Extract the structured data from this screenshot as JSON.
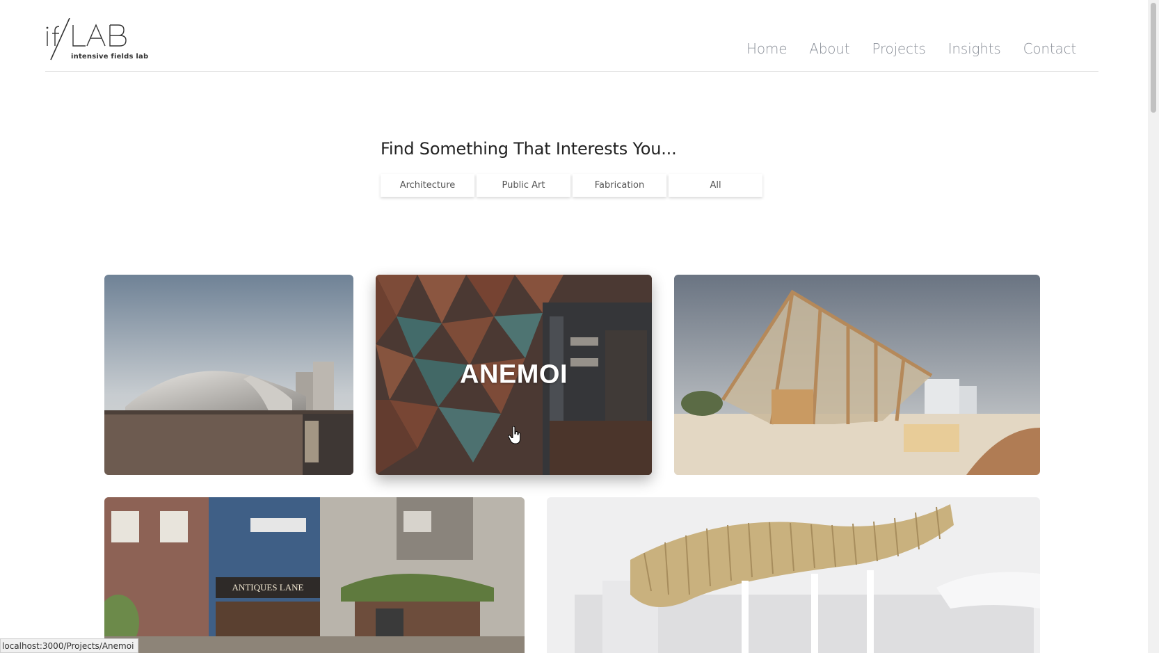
{
  "header": {
    "logo_alt": "if/LAB",
    "logo_subtitle": "intensive fields lab",
    "nav": [
      {
        "label": "Home"
      },
      {
        "label": "About"
      },
      {
        "label": "Projects"
      },
      {
        "label": "Insights"
      },
      {
        "label": "Contact"
      }
    ]
  },
  "filter": {
    "title": "Find Something That Interests You...",
    "buttons": [
      {
        "label": "Architecture"
      },
      {
        "label": "Public Art"
      },
      {
        "label": "Fabrication"
      },
      {
        "label": "All"
      }
    ]
  },
  "projects": [
    {
      "label": ""
    },
    {
      "label": "ANEMOI"
    },
    {
      "label": ""
    },
    {
      "label": "",
      "sign_text": "ANTIQUES LANE"
    },
    {
      "label": ""
    }
  ],
  "status_bar": {
    "url": "localhost:3000/Projects/Anemoi"
  },
  "colors": {
    "nav_text": "#8a8f98",
    "divider": "#dcdcdc",
    "tile_overlay": "#2a2a2a"
  }
}
